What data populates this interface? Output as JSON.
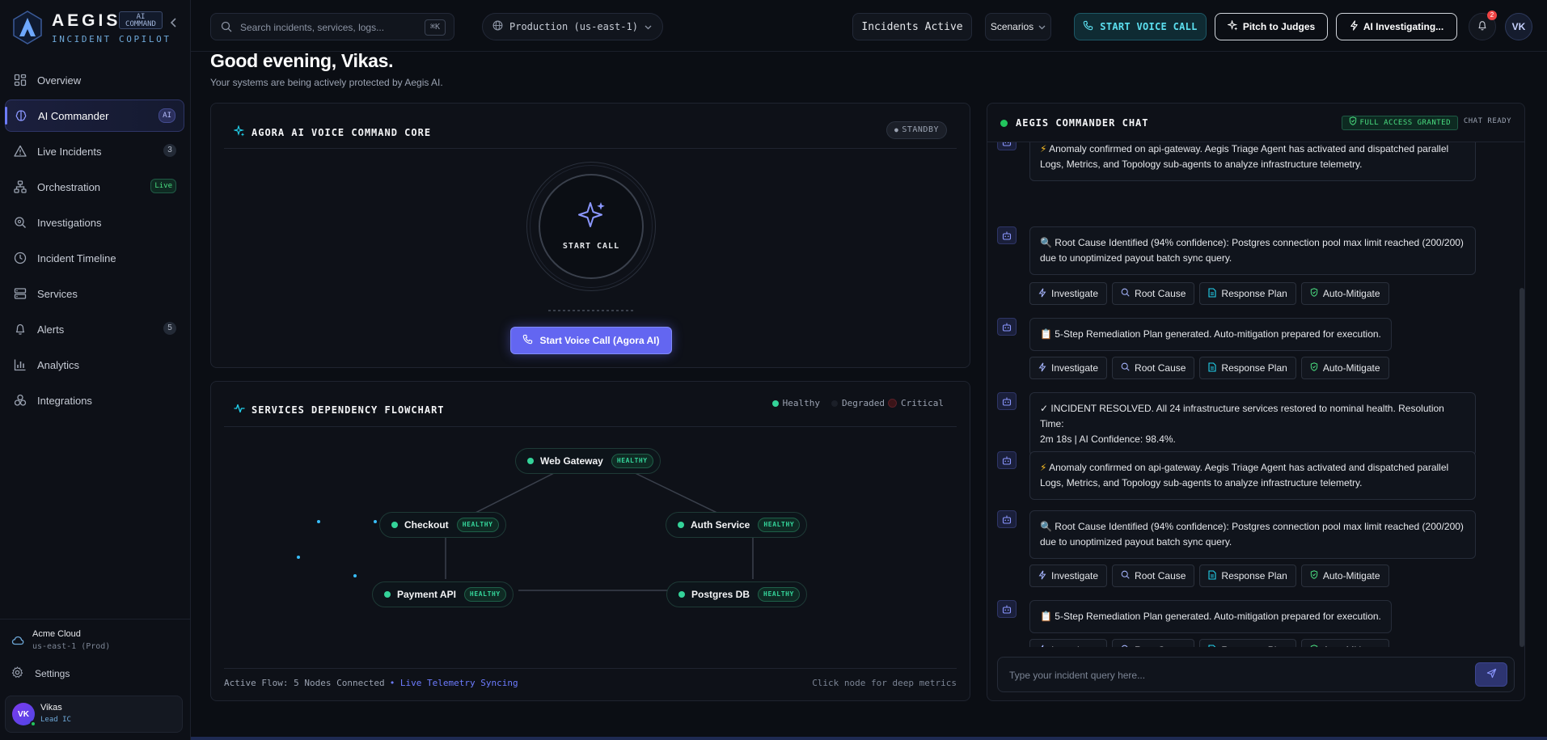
{
  "brand": {
    "name": "AEGIS",
    "badge_line1": "AI",
    "badge_line2": "COMMAND",
    "subtitle": "INCIDENT COPILOT"
  },
  "sidebar": {
    "items": [
      {
        "label": "Overview",
        "icon": "grid-icon"
      },
      {
        "label": "AI Commander",
        "icon": "brain-icon",
        "badge": "AI",
        "active": true
      },
      {
        "label": "Live Incidents",
        "icon": "warning-icon",
        "badge": "3"
      },
      {
        "label": "Orchestration",
        "icon": "network-icon",
        "badge": "Live"
      },
      {
        "label": "Investigations",
        "icon": "magnifier-icon"
      },
      {
        "label": "Incident Timeline",
        "icon": "clock-icon"
      },
      {
        "label": "Services",
        "icon": "server-icon"
      },
      {
        "label": "Alerts",
        "icon": "bell-icon",
        "badge": "5"
      },
      {
        "label": "Analytics",
        "icon": "bar-chart-icon"
      },
      {
        "label": "Integrations",
        "icon": "integrations-icon"
      }
    ],
    "org_name": "Acme Cloud",
    "org_region": "us-east-1 (Prod)",
    "settings_label": "Settings",
    "user": {
      "initials": "VK",
      "name": "Vikas",
      "role": "Lead IC"
    }
  },
  "topbar": {
    "search_placeholder": "Search incidents, services, logs...",
    "search_shortcut": "⌘K",
    "environment": "Production (us-east-1)",
    "incidents_label": "Incidents Active",
    "scenarios_label": "Scenarios",
    "voice_label": "START VOICE CALL",
    "pitch_label": "Pitch to Judges",
    "ai_label": "AI Investigating...",
    "notifications_count": "2",
    "avatar_initials": "VK"
  },
  "greeting": {
    "title": "Good evening, Vikas.",
    "subtitle": "Your systems are being actively protected by Aegis AI."
  },
  "voice_core": {
    "title": "AGORA AI VOICE COMMAND CORE",
    "status": "STANDBY",
    "ring_label": "START CALL",
    "button_label": "Start Voice Call (Agora AI)"
  },
  "flowchart": {
    "title": "SERVICES DEPENDENCY FLOWCHART",
    "legend": {
      "healthy": "Healthy",
      "degraded": "Degraded",
      "critical": "Critical"
    },
    "nodes": [
      {
        "label": "Web Gateway",
        "status": "HEALTHY"
      },
      {
        "label": "Checkout",
        "status": "HEALTHY"
      },
      {
        "label": "Auth Service",
        "status": "HEALTHY"
      },
      {
        "label": "Payment API",
        "status": "HEALTHY"
      },
      {
        "label": "Postgres DB",
        "status": "HEALTHY"
      }
    ],
    "footer_left": "Active Flow: 5 Nodes Connected",
    "footer_live": "• Live Telemetry Syncing",
    "footer_right": "Click node for deep metrics"
  },
  "chat": {
    "title": "AEGIS COMMANDER CHAT",
    "access_label": "FULL ACCESS GRANTED",
    "status": "CHAT READY",
    "actions": {
      "investigate": "Investigate",
      "root_cause": "Root Cause",
      "response_plan": "Response Plan",
      "auto_mitigate": "Auto-Mitigate"
    },
    "messages": [
      {
        "icon": "⚡",
        "line1": "Anomaly confirmed on api-gateway. Aegis Triage Agent has activated and dispatched parallel",
        "line2": "Logs, Metrics, and Topology sub-agents to analyze infrastructure telemetry."
      },
      {
        "icon": "🔍",
        "line1": "Root Cause Identified (94% confidence): Postgres connection pool max limit reached (200/200)",
        "line2": "due to unoptimized payout batch sync query."
      },
      {
        "icon": "📋",
        "line1": "5-Step Remediation Plan generated. Auto-mitigation prepared for execution."
      },
      {
        "icon": "✓",
        "line1": "INCIDENT RESOLVED. All 24 infrastructure services restored to nominal health. Resolution Time:",
        "line2": "2m 18s | AI Confidence: 98.4%."
      },
      {
        "icon": "⚡",
        "line1": "Anomaly confirmed on api-gateway. Aegis Triage Agent has activated and dispatched parallel",
        "line2": "Logs, Metrics, and Topology sub-agents to analyze infrastructure telemetry."
      },
      {
        "icon": "🔍",
        "line1": "Root Cause Identified (94% confidence): Postgres connection pool max limit reached (200/200)",
        "line2": "due to unoptimized payout batch sync query."
      },
      {
        "icon": "📋",
        "line1": "5-Step Remediation Plan generated. Auto-mitigation prepared for execution."
      }
    ],
    "input_placeholder": "Type your incident query here..."
  },
  "colors": {
    "accent": "#6366f1",
    "healthy": "#34d399",
    "critical": "#ef4444",
    "voice": "#5ce0f0"
  }
}
